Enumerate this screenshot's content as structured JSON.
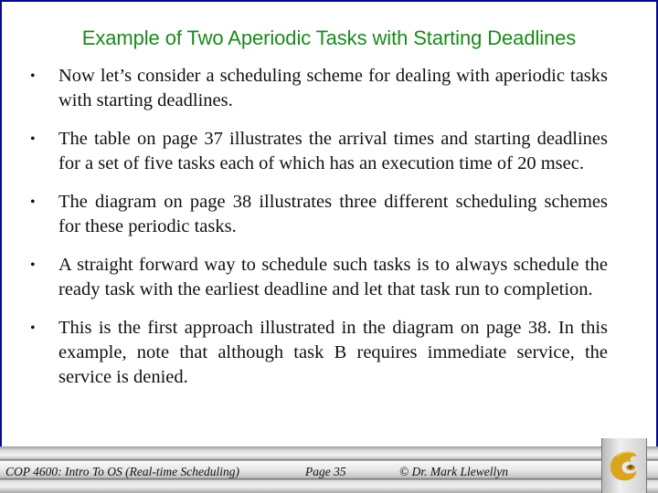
{
  "slide": {
    "title": "Example of Two Aperiodic Tasks with Starting Deadlines",
    "bullet_glyph": "•",
    "bullets": [
      "Now let’s consider a scheduling scheme for dealing with aperiodic tasks with starting deadlines.",
      "The table on page 37 illustrates the arrival times and starting deadlines for a set of five tasks each of which has an execution time of 20 msec.",
      "The diagram on page 38 illustrates three different scheduling schemes for these periodic tasks.",
      "A straight forward way to schedule such tasks is to always schedule the ready task with the earliest deadline and let that task run to completion.",
      "This is the first approach illustrated in the diagram on page 38.  In this example, note that although task B requires immediate service, the service is denied."
    ]
  },
  "footer": {
    "course": "COP 4600: Intro To OS  (Real-time Scheduling)",
    "page": "Page 35",
    "copyright": "© Dr. Mark Llewellyn",
    "logo_icon": "pegasus-logo-icon"
  },
  "colors": {
    "title": "#1a8a1a",
    "border": "#0a0a8c",
    "logo_gold": "#d9a520"
  }
}
